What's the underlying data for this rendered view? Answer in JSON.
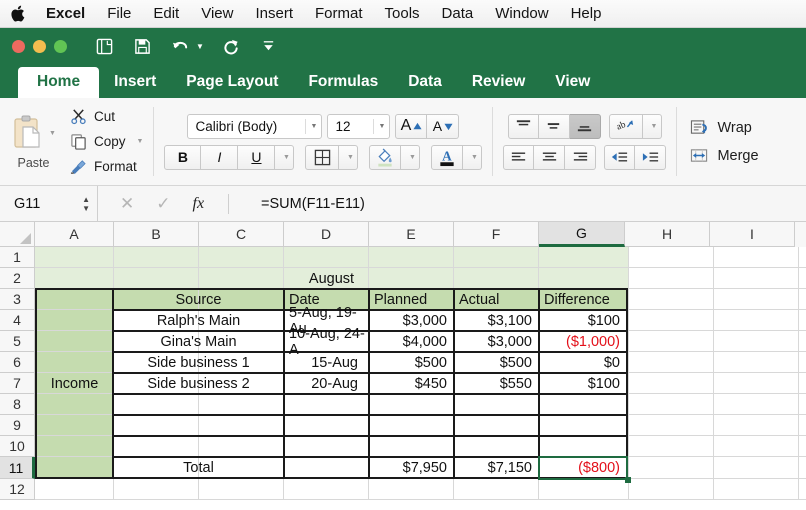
{
  "menubar": {
    "apple": "apple-logo",
    "items": [
      "Excel",
      "File",
      "Edit",
      "View",
      "Insert",
      "Format",
      "Tools",
      "Data",
      "Window",
      "Help"
    ]
  },
  "quick_access": {
    "icons": [
      "new-document-icon",
      "save-icon",
      "undo-icon",
      "redo-icon",
      "customize-toolbar-icon"
    ]
  },
  "ribbon_tabs": {
    "active": "Home",
    "items": [
      "Home",
      "Insert",
      "Page Layout",
      "Formulas",
      "Data",
      "Review",
      "View"
    ]
  },
  "ribbon": {
    "paste_label": "Paste",
    "clipboard": [
      {
        "label": "Cut",
        "icon": "scissors-icon",
        "has_caret": false
      },
      {
        "label": "Copy",
        "icon": "copy-icon",
        "has_caret": true
      },
      {
        "label": "Format",
        "icon": "format-painter-icon",
        "has_caret": false
      }
    ],
    "font_name": "Calibri (Body)",
    "font_size": "12",
    "grow_font": "A",
    "shrink_font": "A",
    "bold": "B",
    "italic": "I",
    "underline": "U",
    "borders_icon": "borders-icon",
    "fill_color_icon": "fill-color-icon",
    "font_color_icon": "font-color-icon",
    "valign": [
      "align-top-icon",
      "align-middle-icon",
      "align-bottom-icon"
    ],
    "valign_active_index": 2,
    "orientation_icon": "text-orientation-icon",
    "halign": [
      "align-left-icon",
      "align-center-icon",
      "align-right-icon"
    ],
    "indent": [
      "decrease-indent-icon",
      "increase-indent-icon"
    ],
    "wrap_label": "Wrap",
    "merge_label": "Merge"
  },
  "formula_bar": {
    "name_box": "G11",
    "cancel_icon": "cancel-icon",
    "confirm_icon": "confirm-icon",
    "function_icon": "fx",
    "formula": "=SUM(F11-E11)"
  },
  "grid": {
    "column_headers": [
      "A",
      "B",
      "C",
      "D",
      "E",
      "F",
      "G",
      "H",
      "I"
    ],
    "selected_column": "G",
    "row_headers": [
      "1",
      "2",
      "3",
      "4",
      "5",
      "6",
      "7",
      "8",
      "9",
      "10",
      "11",
      "12"
    ],
    "selected_row": "11",
    "selected_cell": "G11",
    "colors": {
      "header_fill": "#c5dcaf",
      "title_fill": "#e3eeda",
      "selection_border": "#1e6b40",
      "negative_text": "#e3101a"
    },
    "title": "August",
    "category_label": "Income",
    "table_headers": [
      "Source",
      "Date",
      "Planned",
      "Actual",
      "Difference"
    ],
    "rows": [
      {
        "source": "Ralph's Main",
        "date": "5-Aug, 19-Au",
        "planned": "$3,000",
        "actual": "$3,100",
        "difference": "$100",
        "negative": false
      },
      {
        "source": "Gina's Main",
        "date": "10-Aug, 24-A",
        "planned": "$4,000",
        "actual": "$3,000",
        "difference": "($1,000)",
        "negative": true
      },
      {
        "source": "Side business 1",
        "date": "15-Aug",
        "planned": "$500",
        "actual": "$500",
        "difference": "$0",
        "negative": false
      },
      {
        "source": "Side business 2",
        "date": "20-Aug",
        "planned": "$450",
        "actual": "$550",
        "difference": "$100",
        "negative": false
      },
      {
        "source": "",
        "date": "",
        "planned": "",
        "actual": "",
        "difference": "",
        "negative": false
      },
      {
        "source": "",
        "date": "",
        "planned": "",
        "actual": "",
        "difference": "",
        "negative": false
      },
      {
        "source": "",
        "date": "",
        "planned": "",
        "actual": "",
        "difference": "",
        "negative": false
      }
    ],
    "total_row": {
      "label": "Total",
      "date": "",
      "planned": "$7,950",
      "actual": "$7,150",
      "difference": "($800)",
      "negative": true
    }
  }
}
